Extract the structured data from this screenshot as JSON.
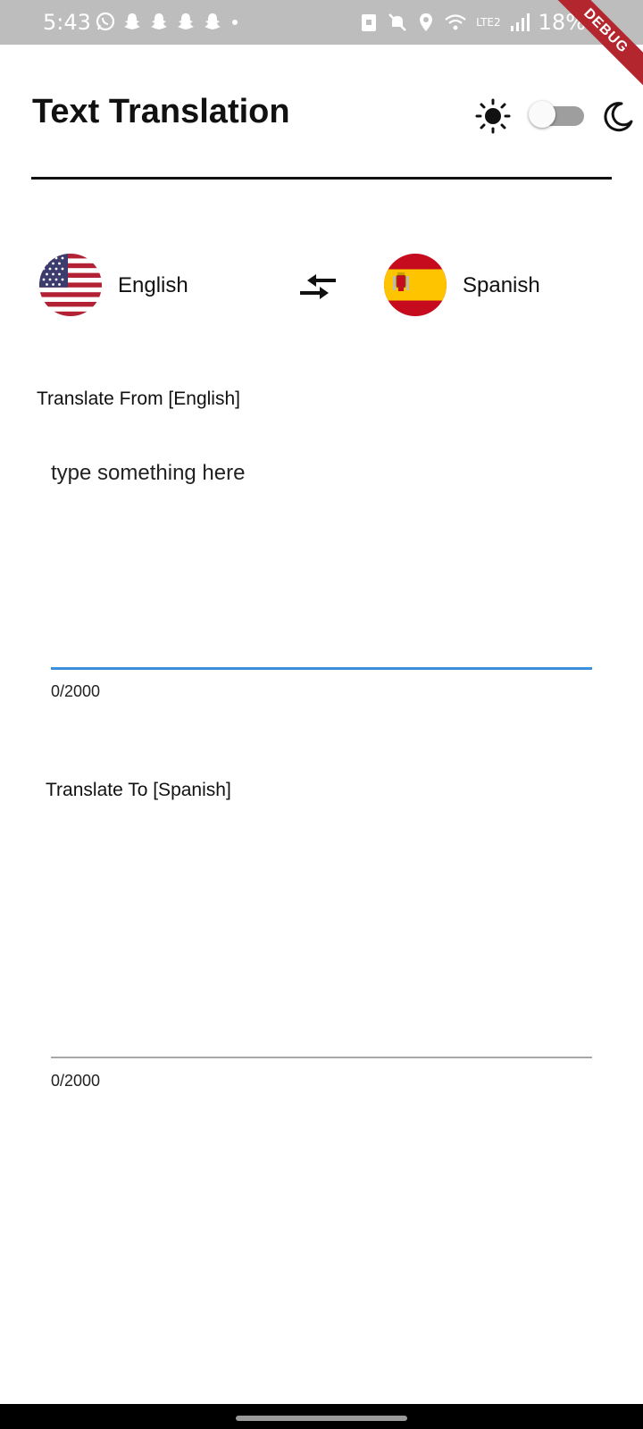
{
  "status_bar": {
    "time": "5:43",
    "battery": "18%",
    "network": "LTE2",
    "notification_icons": [
      "whatsapp-icon",
      "snapchat-icon",
      "snapchat-icon",
      "snapchat-icon",
      "snapchat-icon",
      "dot-icon"
    ],
    "system_icons": [
      "saver-icon",
      "mute-icon",
      "location-icon",
      "wifi-icon",
      "signal-icon"
    ],
    "debug_banner": "DEBUG"
  },
  "header": {
    "title": "Text Translation",
    "theme_toggle": {
      "light_icon": "sun-icon",
      "dark_icon": "moon-icon",
      "dark_mode": false
    }
  },
  "languages": {
    "from": {
      "label": "English",
      "flag": "us-flag"
    },
    "to": {
      "label": "Spanish",
      "flag": "spain-flag"
    },
    "swap_icon": "swap-icon"
  },
  "input": {
    "label": "Translate From [English]",
    "placeholder": "type something here",
    "value": "",
    "counter": "0/2000",
    "accent_color": "#3a8edb"
  },
  "output": {
    "label": "Translate To [Spanish]",
    "value": "",
    "counter": "0/2000"
  }
}
